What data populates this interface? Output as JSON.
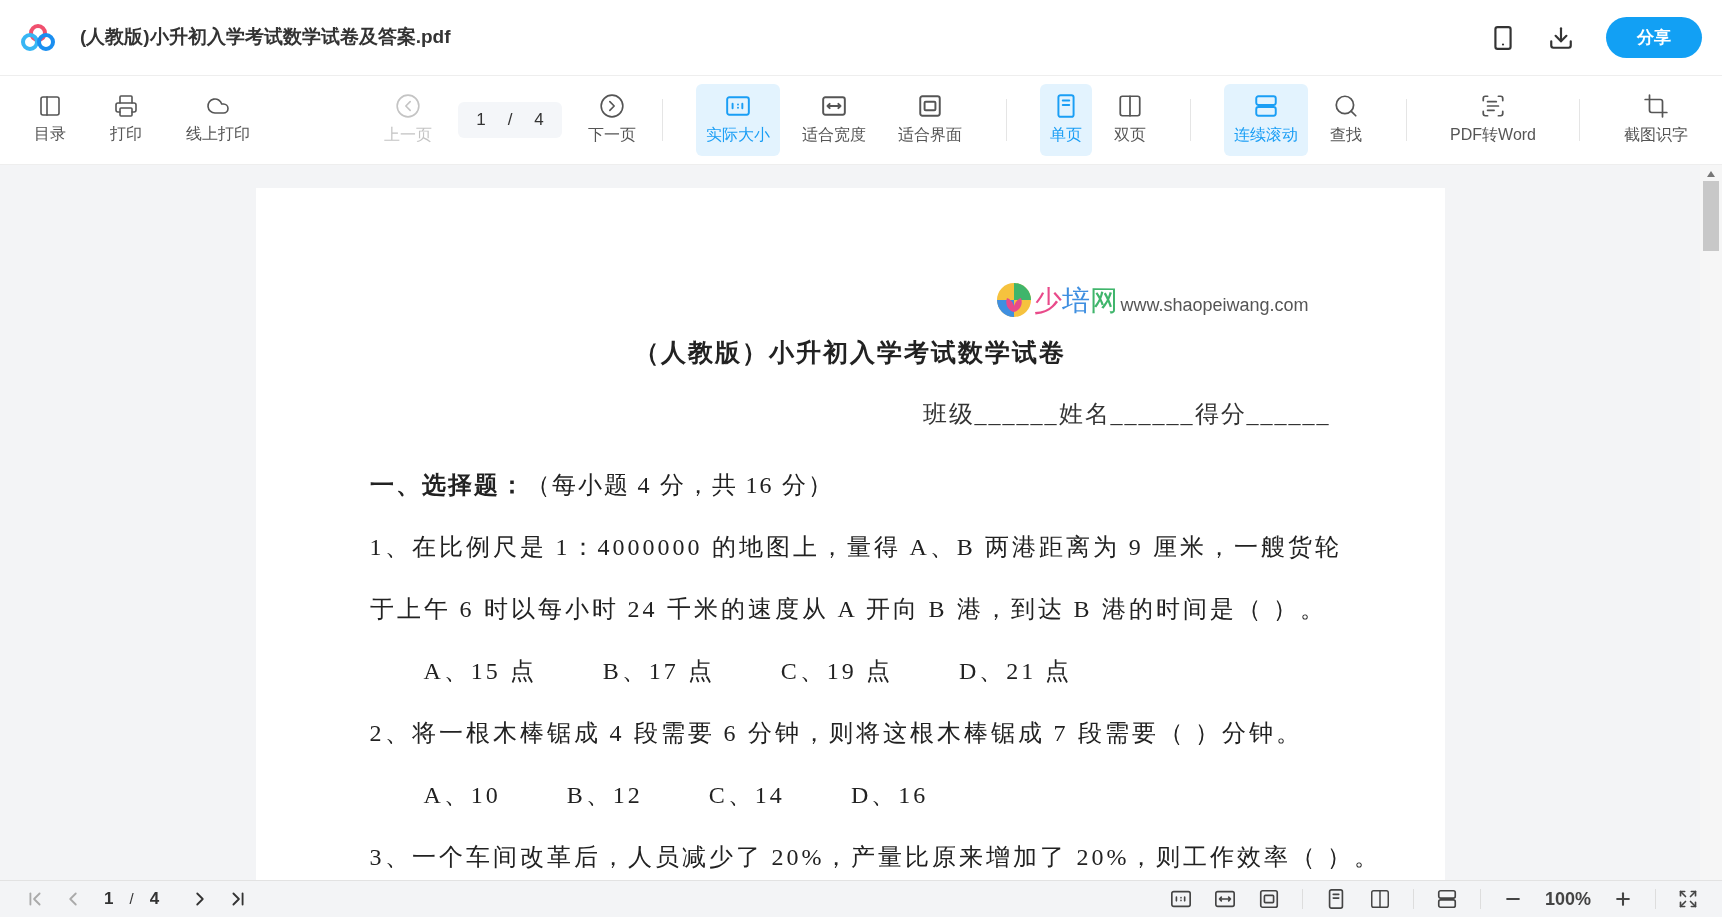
{
  "title_bar": {
    "title": "(人教版)小升初入学考试数学试卷及答案.pdf",
    "share_button": "分享"
  },
  "toolbar": {
    "left": [
      {
        "label": "目录"
      },
      {
        "label": "打印"
      },
      {
        "label": "线上打印"
      }
    ],
    "pager": {
      "prev": {
        "label": "上一页",
        "disabled": true
      },
      "page": "1",
      "separator": "/",
      "total": "4",
      "next": {
        "label": "下一页",
        "disabled": false
      }
    },
    "groups": [
      [
        {
          "label": "实际大小",
          "selected": true
        },
        {
          "label": "适合宽度",
          "selected": false
        },
        {
          "label": "适合界面",
          "selected": false
        }
      ],
      [
        {
          "label": "单页",
          "selected": true
        },
        {
          "label": "双页",
          "selected": false
        }
      ],
      [
        {
          "label": "连续滚动",
          "selected": true
        },
        {
          "label": "查找",
          "selected": false
        }
      ],
      [
        {
          "label": "PDF转Word"
        }
      ],
      [
        {
          "label": "截图识字"
        }
      ]
    ]
  },
  "document": {
    "site_logo": "少培网",
    "site_url": "www.shaopeiwang.com",
    "heading": "（人教版）小升初入学考试数学试卷",
    "info_line": "班级______姓名______得分______",
    "lines": [
      {
        "kind": "section",
        "text": "**一、选择题：**（每小题 4 分，共 16 分）"
      },
      {
        "kind": "text",
        "text": "1、在比例尺是 1：4000000 的地图上，量得 A、B 两港距离为 9 厘米，一艘货轮"
      },
      {
        "kind": "text",
        "text": "于上午 6 时以每小时 24 千米的速度从 A 开向 B 港，到达 B 港的时间是（ ）。"
      },
      {
        "kind": "options",
        "options": [
          "A、15 点",
          "B、17 点",
          "C、19 点",
          "D、21 点"
        ]
      },
      {
        "kind": "text",
        "text": "2、将一根木棒锯成 4 段需要 6 分钟，则将这根木棒锯成 7 段需要（ ）分钟。"
      },
      {
        "kind": "options",
        "options": [
          "A、10",
          "B、12",
          "C、14",
          "D、16"
        ]
      },
      {
        "kind": "text",
        "text": "3、一个车间改革后，人员减少了 20%，产量比原来增加了 20%，则工作效率（ ）。"
      }
    ]
  },
  "bottom_bar": {
    "page": "1",
    "separator": "/",
    "total": "4",
    "zoom": "100%"
  }
}
